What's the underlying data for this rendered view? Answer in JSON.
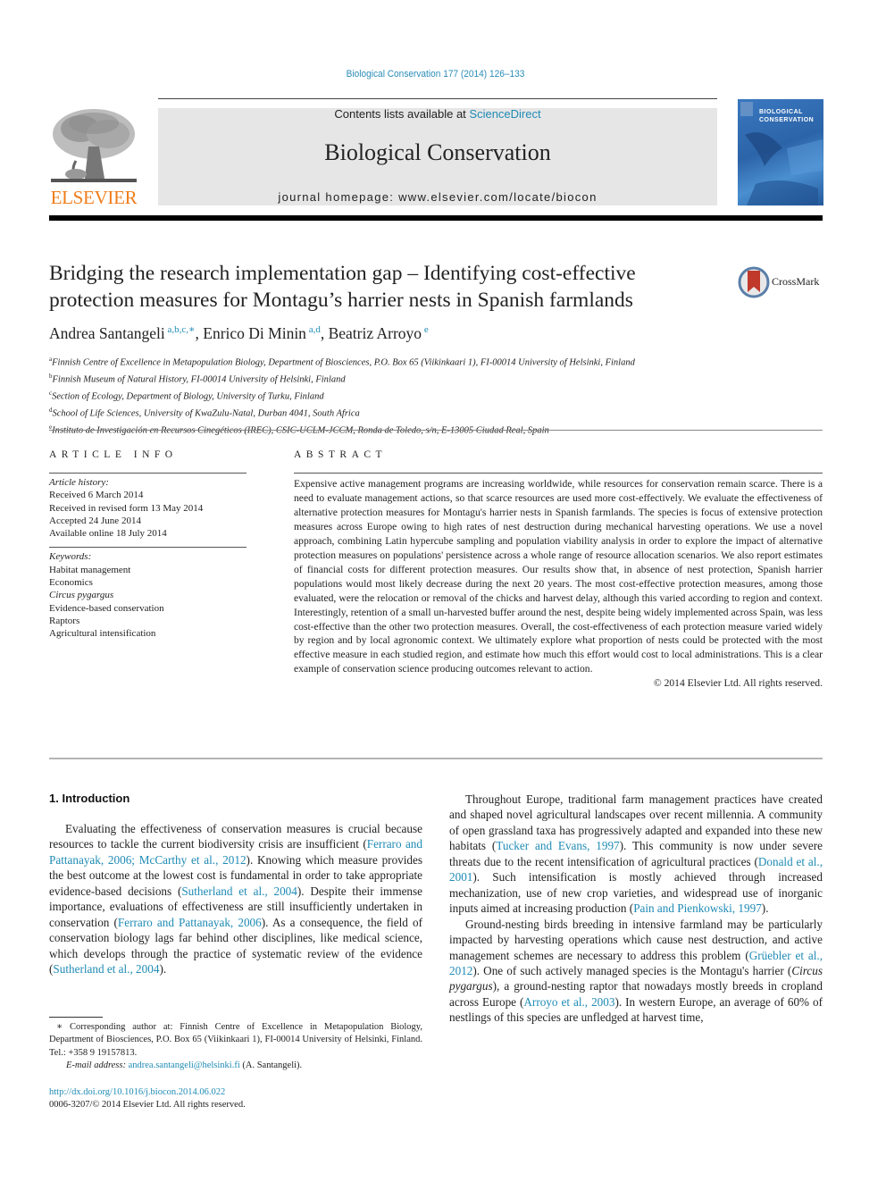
{
  "header": {
    "citation": "Biological Conservation 177 (2014) 126–133",
    "contents_prefix": "Contents lists available at ",
    "contents_link": "ScienceDirect",
    "journal_title": "Biological Conservation",
    "homepage": "journal homepage: www.elsevier.com/locate/biocon",
    "publisher_logo_text": "ELSEVIER",
    "cover_title_line1": "BIOLOGICAL",
    "cover_title_line2": "CONSERVATION",
    "crossmark_label": "CrossMark"
  },
  "colors": {
    "link": "#1f8bb5",
    "elsevier_orange": "#f07d1a",
    "masthead_gray": "#e6e6e6",
    "cover_blue": "#2c64a8"
  },
  "article": {
    "title_line1": "Bridging the research implementation gap – Identifying cost-effective",
    "title_line2": "protection measures for Montagu’s harrier nests in Spanish farmlands",
    "authors": [
      {
        "name": "Andrea Santangeli",
        "sup": "a,b,c,",
        "mark": "∗",
        "sep": ", "
      },
      {
        "name": "Enrico Di Minin",
        "sup": "a,d",
        "mark": "",
        "sep": ", "
      },
      {
        "name": "Beatriz Arroyo",
        "sup": "e",
        "mark": "",
        "sep": ""
      }
    ],
    "affiliations": [
      {
        "key": "a",
        "text": "Finnish Centre of Excellence in Metapopulation Biology, Department of Biosciences, P.O. Box 65 (Viikinkaari 1), FI-00014 University of Helsinki, Finland"
      },
      {
        "key": "b",
        "text": "Finnish Museum of Natural History, FI-00014 University of Helsinki, Finland"
      },
      {
        "key": "c",
        "text": "Section of Ecology, Department of Biology, University of Turku, Finland"
      },
      {
        "key": "d",
        "text": "School of Life Sciences, University of KwaZulu-Natal, Durban 4041, South Africa"
      },
      {
        "key": "e",
        "text": "Instituto de Investigación en Recursos Cinegéticos (IREC), CSIC-UCLM-JCCM, Ronda de Toledo, s/n, E-13005 Ciudad Real, Spain"
      }
    ]
  },
  "article_info": {
    "heading": "ARTICLE INFO",
    "history_label": "Article history:",
    "history": [
      "Received 6 March 2014",
      "Received in revised form 13 May 2014",
      "Accepted 24 June 2014",
      "Available online 18 July 2014"
    ],
    "keywords_label": "Keywords:",
    "keywords": [
      {
        "text": "Habitat management",
        "italic": false
      },
      {
        "text": "Economics",
        "italic": false
      },
      {
        "text": "Circus pygargus",
        "italic": true
      },
      {
        "text": "Evidence-based conservation",
        "italic": false
      },
      {
        "text": "Raptors",
        "italic": false
      },
      {
        "text": "Agricultural intensification",
        "italic": false
      }
    ]
  },
  "abstract": {
    "heading": "ABSTRACT",
    "text": "Expensive active management programs are increasing worldwide, while resources for conservation remain scarce. There is a need to evaluate management actions, so that scarce resources are used more cost-effectively. We evaluate the effectiveness of alternative protection measures for Montagu's harrier nests in Spanish farmlands. The species is focus of extensive protection measures across Europe owing to high rates of nest destruction during mechanical harvesting operations. We use a novel approach, combining Latin hypercube sampling and population viability analysis in order to explore the impact of alternative protection measures on populations' persistence across a whole range of resource allocation scenarios. We also report estimates of financial costs for different protection measures. Our results show that, in absence of nest protection, Spanish harrier populations would most likely decrease during the next 20 years. The most cost-effective protection measures, among those evaluated, were the relocation or removal of the chicks and harvest delay, although this varied according to region and context. Interestingly, retention of a small un-harvested buffer around the nest, despite being widely implemented across Spain, was less cost-effective than the other two protection measures. Overall, the cost-effectiveness of each protection measure varied widely by region and by local agronomic context. We ultimately explore what proportion of nests could be protected with the most effective measure in each studied region, and estimate how much this effort would cost to local administrations. This is a clear example of conservation science producing outcomes relevant to action.",
    "copyright": "© 2014 Elsevier Ltd. All rights reserved."
  },
  "body": {
    "intro_heading": "1. Introduction",
    "left_paragraph": [
      {
        "t": "Evaluating the effectiveness of conservation measures is crucial because resources to tackle the current biodiversity crisis are insufficient ("
      },
      {
        "l": "Ferraro and Pattanayak, 2006; McCarthy et al., 2012"
      },
      {
        "t": "). Knowing which measure provides the best outcome at the lowest cost is fundamental in order to take appropriate evidence-based decisions ("
      },
      {
        "l": "Sutherland et al., 2004"
      },
      {
        "t": "). Despite their immense importance, evaluations of effectiveness are still insufficiently undertaken in conservation ("
      },
      {
        "l": "Ferraro and Pattanayak, 2006"
      },
      {
        "t": "). As a consequence, the field of conservation biology lags far behind other disciplines, like medical science, which develops through the practice of systematic review of the evidence ("
      },
      {
        "l": "Sutherland et al., 2004"
      },
      {
        "t": ")."
      }
    ],
    "right_paragraph_1": [
      {
        "t": "Throughout Europe, traditional farm management practices have created and shaped novel agricultural landscapes over recent millennia. A community of open grassland taxa has progressively adapted and expanded into these new habitats ("
      },
      {
        "l": "Tucker and Evans, 1997"
      },
      {
        "t": "). This community is now under severe threats due to the recent intensification of agricultural practices ("
      },
      {
        "l": "Donald et al., 2001"
      },
      {
        "t": "). Such intensification is mostly achieved through increased mechanization, use of new crop varieties, and widespread use of inorganic inputs aimed at increasing production ("
      },
      {
        "l": "Pain and Pienkowski, 1997"
      },
      {
        "t": ")."
      }
    ],
    "right_paragraph_2": [
      {
        "t": "Ground-nesting birds breeding in intensive farmland may be particularly impacted by harvesting operations which cause nest destruction, and active management schemes are necessary to address this problem ("
      },
      {
        "l": "Grüebler et al., 2012"
      },
      {
        "t": "). One of such actively managed species is the Montagu's harrier ("
      },
      {
        "i": "Circus pygargus"
      },
      {
        "t": "), a ground-nesting raptor that nowadays mostly breeds in cropland across Europe ("
      },
      {
        "l": "Arroyo et al., 2003"
      },
      {
        "t": "). In western Europe, an average of 60% of nestlings of this species are unfledged at harvest time,"
      }
    ]
  },
  "footnote": {
    "mark": "∗",
    "text": " Corresponding author at: Finnish Centre of Excellence in Metapopulation Biology, Department of Biosciences, P.O. Box 65 (Viikinkaari 1), FI-00014 University of Helsinki, Finland. Tel.: +358 9 19157813.",
    "email_label": "E-mail address: ",
    "email": "andrea.santangeli@helsinki.fi",
    "email_suffix": " (A. Santangeli).",
    "doi": "http://dx.doi.org/10.1016/j.biocon.2014.06.022",
    "issn_line": "0006-3207/© 2014 Elsevier Ltd. All rights reserved."
  }
}
